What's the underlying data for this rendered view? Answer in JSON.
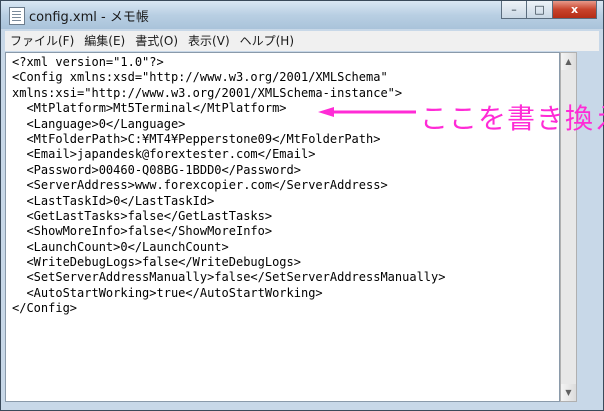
{
  "window": {
    "title": "config.xml - メモ帳",
    "buttons": {
      "minimize": "–",
      "maximize": "□",
      "close": "x"
    }
  },
  "menu": [
    "ファイル(F)",
    "編集(E)",
    "書式(O)",
    "表示(V)",
    "ヘルプ(H)"
  ],
  "editor": {
    "lines": [
      "<?xml version=\"1.0\"?>",
      "<Config xmlns:xsd=\"http://www.w3.org/2001/XMLSchema\"",
      "xmlns:xsi=\"http://www.w3.org/2001/XMLSchema-instance\">",
      "  <MtPlatform>Mt5Terminal</MtPlatform>",
      "  <Language>0</Language>",
      "  <MtFolderPath>C:¥MT4¥Pepperstone09</MtFolderPath>",
      "  <Email>japandesk@forextester.com</Email>",
      "  <Password>00460-Q08BG-1BDD0</Password>",
      "  <ServerAddress>www.forexcopier.com</ServerAddress>",
      "  <LastTaskId>0</LastTaskId>",
      "  <GetLastTasks>false</GetLastTasks>",
      "  <ShowMoreInfo>false</ShowMoreInfo>",
      "  <LaunchCount>0</LaunchCount>",
      "  <WriteDebugLogs>false</WriteDebugLogs>",
      "  <SetServerAddressManually>false</SetServerAddressManually>",
      "  <AutoStartWorking>true</AutoStartWorking>",
      "</Config>"
    ]
  },
  "annotation": {
    "text": "ここを書き換え",
    "color": "#ff2bd6"
  },
  "colors": {
    "title_bar": "#b9cfe3",
    "close_button": "#c8432c",
    "editor_background": "#ffffff"
  }
}
